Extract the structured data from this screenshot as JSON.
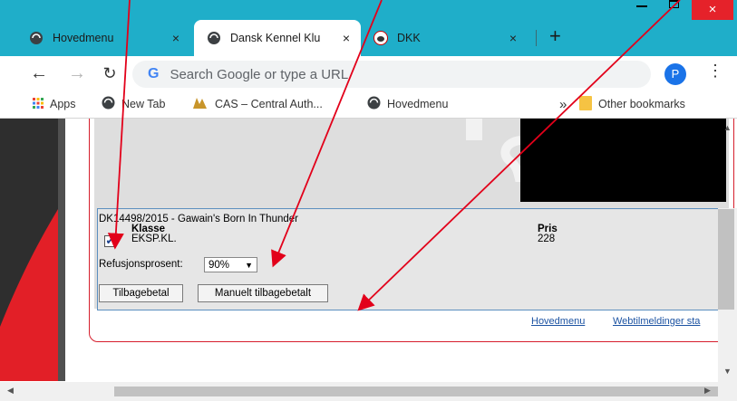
{
  "browser": {
    "tabs": [
      {
        "label": "Hovedmenu",
        "close": "×"
      },
      {
        "label": "Dansk Kennel Klu",
        "close": "×"
      },
      {
        "label": "DKK",
        "close": "×"
      }
    ],
    "new_tab": "+",
    "window_close": "×",
    "omnibox_placeholder": "Search Google or type a URL",
    "omnibox_logo": "G",
    "profile_initial": "P",
    "menu": "⋮"
  },
  "bookmarks": {
    "items": [
      {
        "label": "Apps",
        "icon": "apps-grid-icon"
      },
      {
        "label": "New Tab",
        "icon": "globe-icon"
      },
      {
        "label": "CAS – Central Auth...",
        "icon": "cas-logo-icon"
      },
      {
        "label": "Hovedmenu",
        "icon": "globe-icon"
      }
    ],
    "overflow": "»",
    "other": "Other bookmarks"
  },
  "entry": {
    "title": "DK14498/2015 - Gawain's Born In Thunder",
    "class_header": "Klasse",
    "class_value": "EKSP.KL.",
    "price_header": "Pris",
    "price_value": "228",
    "checked": true,
    "refund_label": "Refusjonsprosent:",
    "refund_value": "90%",
    "refund_button": "Tilbagebetal",
    "manual_button": "Manuelt tilbagebetalt"
  },
  "footer_links": {
    "home": "Hovedmenu",
    "web": "Webtilmeldinger sta"
  },
  "colors": {
    "tabstrip": "#1faec9",
    "frame_border": "#d61e2c",
    "annotation": "#e2001a",
    "link": "#1c53a2"
  }
}
